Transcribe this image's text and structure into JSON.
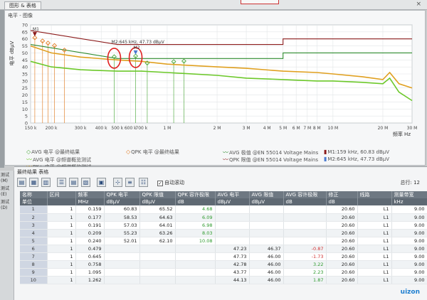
{
  "window": {
    "tab_label": "图形 & 表格",
    "watermark": "uizon"
  },
  "chart_panel": {
    "title": "电平 - 图像"
  },
  "chart_data": {
    "type": "line",
    "ylabel": "电平 dBμV",
    "xlabel": "频率 Hz",
    "x_scale": "log",
    "xlim_hz": [
      150000,
      30000000
    ],
    "ylim": [
      0,
      70
    ],
    "y_ticks": [
      70,
      65,
      60,
      55,
      50,
      45,
      40,
      35,
      30,
      25,
      20,
      15,
      10,
      5,
      0
    ],
    "x_ticks": [
      {
        "hz": 150000,
        "label": "150 k"
      },
      {
        "hz": 200000,
        "label": "200 k"
      },
      {
        "hz": 300000,
        "label": "300 k"
      },
      {
        "hz": 400000,
        "label": "400 k"
      },
      {
        "hz": 500000,
        "label": "500 k"
      },
      {
        "hz": 600000,
        "label": "600 k"
      },
      {
        "hz": 700000,
        "label": "700 k"
      },
      {
        "hz": 1000000,
        "label": "1 M"
      },
      {
        "hz": 2000000,
        "label": "2 M"
      },
      {
        "hz": 3000000,
        "label": "3 M"
      },
      {
        "hz": 4000000,
        "label": "4 M"
      },
      {
        "hz": 5000000,
        "label": "5 M"
      },
      {
        "hz": 6000000,
        "label": "6 M"
      },
      {
        "hz": 7000000,
        "label": "7 M"
      },
      {
        "hz": 8000000,
        "label": "8 M"
      },
      {
        "hz": 10000000,
        "label": "10 M"
      },
      {
        "hz": 20000000,
        "label": "20 M"
      },
      {
        "hz": 30000000,
        "label": "30 M"
      }
    ],
    "grid": true,
    "series": [
      {
        "name": "QPK 限值 @EN 55014 Voltage Mains",
        "color": "#8b1a1a",
        "points": [
          [
            150000,
            66
          ],
          [
            500000,
            56
          ],
          [
            5000000,
            56
          ],
          [
            5000000,
            60
          ],
          [
            30000000,
            60
          ]
        ]
      },
      {
        "name": "AVG 限值 @EN 55014 Voltage Mains",
        "color": "#2e8b2e",
        "points": [
          [
            150000,
            56
          ],
          [
            500000,
            46
          ],
          [
            5000000,
            46
          ],
          [
            5000000,
            50
          ],
          [
            30000000,
            50
          ]
        ]
      },
      {
        "name": "PK+ 电平 @频谱概览测试",
        "color": "#e0a020",
        "points": [
          [
            150000,
            55
          ],
          [
            200000,
            50
          ],
          [
            300000,
            47
          ],
          [
            500000,
            45
          ],
          [
            700000,
            44
          ],
          [
            1000000,
            42
          ],
          [
            2000000,
            40
          ],
          [
            3000000,
            39
          ],
          [
            5000000,
            37
          ],
          [
            8000000,
            36
          ],
          [
            10000000,
            35
          ],
          [
            15000000,
            33
          ],
          [
            20000000,
            31
          ],
          [
            22000000,
            36
          ],
          [
            25000000,
            28
          ],
          [
            30000000,
            25
          ]
        ]
      },
      {
        "name": "AVG 电平 @频谱概览测试",
        "color": "#6cc82a",
        "points": [
          [
            150000,
            44
          ],
          [
            200000,
            40
          ],
          [
            300000,
            38
          ],
          [
            500000,
            37
          ],
          [
            700000,
            37
          ],
          [
            1000000,
            36
          ],
          [
            2000000,
            34
          ],
          [
            3000000,
            32
          ],
          [
            5000000,
            31
          ],
          [
            8000000,
            30
          ],
          [
            10000000,
            30
          ],
          [
            15000000,
            29
          ],
          [
            20000000,
            28
          ],
          [
            22000000,
            32
          ],
          [
            25000000,
            22
          ],
          [
            30000000,
            16
          ]
        ]
      },
      {
        "name": "QPK 电平 @最终结果",
        "color": "#e07a20",
        "points": [
          [
            159000,
            60.83
          ],
          [
            177000,
            58.53
          ],
          [
            191000,
            57.03
          ],
          [
            209000,
            55.23
          ],
          [
            240000,
            52.01
          ]
        ]
      },
      {
        "name": "AVG 电平 @最终结果",
        "color": "#4aa83a",
        "points": [
          [
            479000,
            47.23
          ],
          [
            645000,
            47.73
          ],
          [
            758000,
            42.78
          ],
          [
            1095000,
            43.77
          ],
          [
            1262000,
            44.13
          ]
        ]
      }
    ],
    "markers": [
      {
        "label": "M1",
        "hz": 159000,
        "value": 60.83
      },
      {
        "label": "M2",
        "hz": 645000,
        "value": 47.73,
        "annotation": "M2:645 kHz, 47.73 dBμV"
      }
    ],
    "circled_points": [
      {
        "hz": 479000,
        "value": 47.23
      },
      {
        "hz": 645000,
        "value": 47.73
      }
    ]
  },
  "legend": {
    "avg_final": "AVG 电平 @最终结果",
    "qpk_final": "QPK 电平 @最终结果",
    "avg_limit": "AVG 极值 @EN 55014 Voltage Mains",
    "qpk_limit": "QPK 限值 @EN 55014 Voltage Mains",
    "m1": "M1:159 kHz, 60.83 dBμV",
    "avg_overview": "AVG 电平 @频谱概览测试",
    "pk_overview": "PK+ 电平 @频谱概览测试",
    "m2": "M2:645 kHz, 47.73 dBμV"
  },
  "side": {
    "label1": "测试(M)",
    "label2": "测试(E)",
    "label3": "测试(D)"
  },
  "results": {
    "title": "最终结果 表格",
    "autoscroll_label": "自动滚动",
    "row_count": "总行: 12",
    "headers": [
      "名称",
      "区间",
      "频率",
      "QPK 电平",
      "QPK 限值",
      "QPK 容许极限",
      "AVG 电平",
      "AVG 限值",
      "AVG 容许极限",
      "修正",
      "线路",
      "测量带宽"
    ],
    "units": [
      "单位",
      "",
      "MHz",
      "dBμV",
      "dBμV",
      "dB",
      "dBμV",
      "dBμV",
      "dB",
      "dB",
      "",
      "kHz"
    ],
    "rows": [
      [
        "1",
        "1",
        "0.159",
        "60.83",
        "65.52",
        "4.68",
        "",
        "",
        "",
        "20.60",
        "L1",
        "9.00"
      ],
      [
        "2",
        "1",
        "0.177",
        "58.53",
        "64.63",
        "6.09",
        "",
        "",
        "",
        "20.60",
        "L1",
        "9.00"
      ],
      [
        "3",
        "1",
        "0.191",
        "57.03",
        "64.01",
        "6.98",
        "",
        "",
        "",
        "20.60",
        "L1",
        "9.00"
      ],
      [
        "4",
        "1",
        "0.209",
        "55.23",
        "63.26",
        "8.03",
        "",
        "",
        "",
        "20.60",
        "L1",
        "9.00"
      ],
      [
        "5",
        "1",
        "0.240",
        "52.01",
        "62.10",
        "10.08",
        "",
        "",
        "",
        "20.60",
        "L1",
        "9.00"
      ],
      [
        "6",
        "1",
        "0.479",
        "",
        "",
        "",
        "47.23",
        "46.37",
        "-0.87",
        "20.60",
        "L1",
        "9.00"
      ],
      [
        "7",
        "1",
        "0.645",
        "",
        "",
        "",
        "47.73",
        "46.00",
        "-1.73",
        "20.60",
        "L1",
        "9.00"
      ],
      [
        "8",
        "1",
        "0.758",
        "",
        "",
        "",
        "42.78",
        "46.00",
        "3.22",
        "20.60",
        "L1",
        "9.00"
      ],
      [
        "9",
        "1",
        "1.095",
        "",
        "",
        "",
        "43.77",
        "46.00",
        "2.23",
        "20.60",
        "L1",
        "9.00"
      ],
      [
        "10",
        "1",
        "1.262",
        "",
        "",
        "",
        "44.13",
        "46.00",
        "1.87",
        "20.60",
        "L1",
        "9.00"
      ]
    ]
  }
}
